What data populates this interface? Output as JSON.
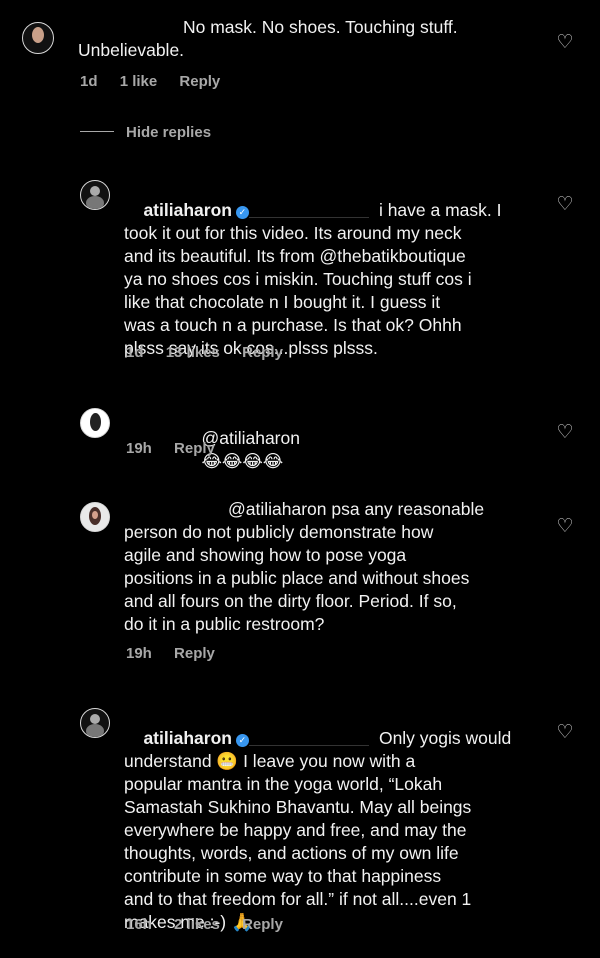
{
  "comments": [
    {
      "text": "No mask. No shoes. Touching stuff.\nUnbelievable.",
      "time": "1d",
      "likes": "1 like",
      "reply": "Reply"
    },
    {
      "username": "atiliaharon",
      "text": "i have a mask. I\ntook it out for this video. Its around my neck\nand its beautiful. Its from @thebatikboutique\nya no shoes cos i miskin. Touching stuff cos i\nlike that chocolate n I bought it. I guess it\nwas a touch n a purchase. Is that ok? Ohhh\nplsss say its ok cos...plsss plsss.",
      "time": "1d",
      "likes": "13 likes",
      "reply": "Reply"
    },
    {
      "text": "@atiliaharon",
      "emojis": "😂😂😂😂",
      "time": "19h",
      "reply": "Reply"
    },
    {
      "text": "@atiliaharon psa any reasonable\nperson do not publicly demonstrate how\nagile and showing how to pose yoga\npositions in a public place and without shoes\nand all fours on the dirty floor. Period. If so,\ndo it in a public restroom?",
      "time": "19h",
      "reply": "Reply"
    },
    {
      "username": "atiliaharon",
      "text": "Only yogis would\nunderstand 😬 I leave you now with a\npopular mantra in the yoga world, “Lokah\nSamastah Sukhino Bhavantu. May all beings\neverywhere be happy and free, and may the\nthoughts, words, and actions of my own life\ncontribute in some way to that happiness\nand to that freedom for all.” if not all....even 1\nmakes me :-) 🙏",
      "time": "16h",
      "likes": "2 likes",
      "reply": "Reply"
    }
  ],
  "hide_replies": "Hide replies",
  "icons": {
    "heart": "heart-outline-icon",
    "verified": "verified-badge-icon"
  },
  "colors": {
    "background": "#000000",
    "text": "#f2f2f2",
    "meta": "#a8a8a8",
    "verified": "#3897f0"
  }
}
